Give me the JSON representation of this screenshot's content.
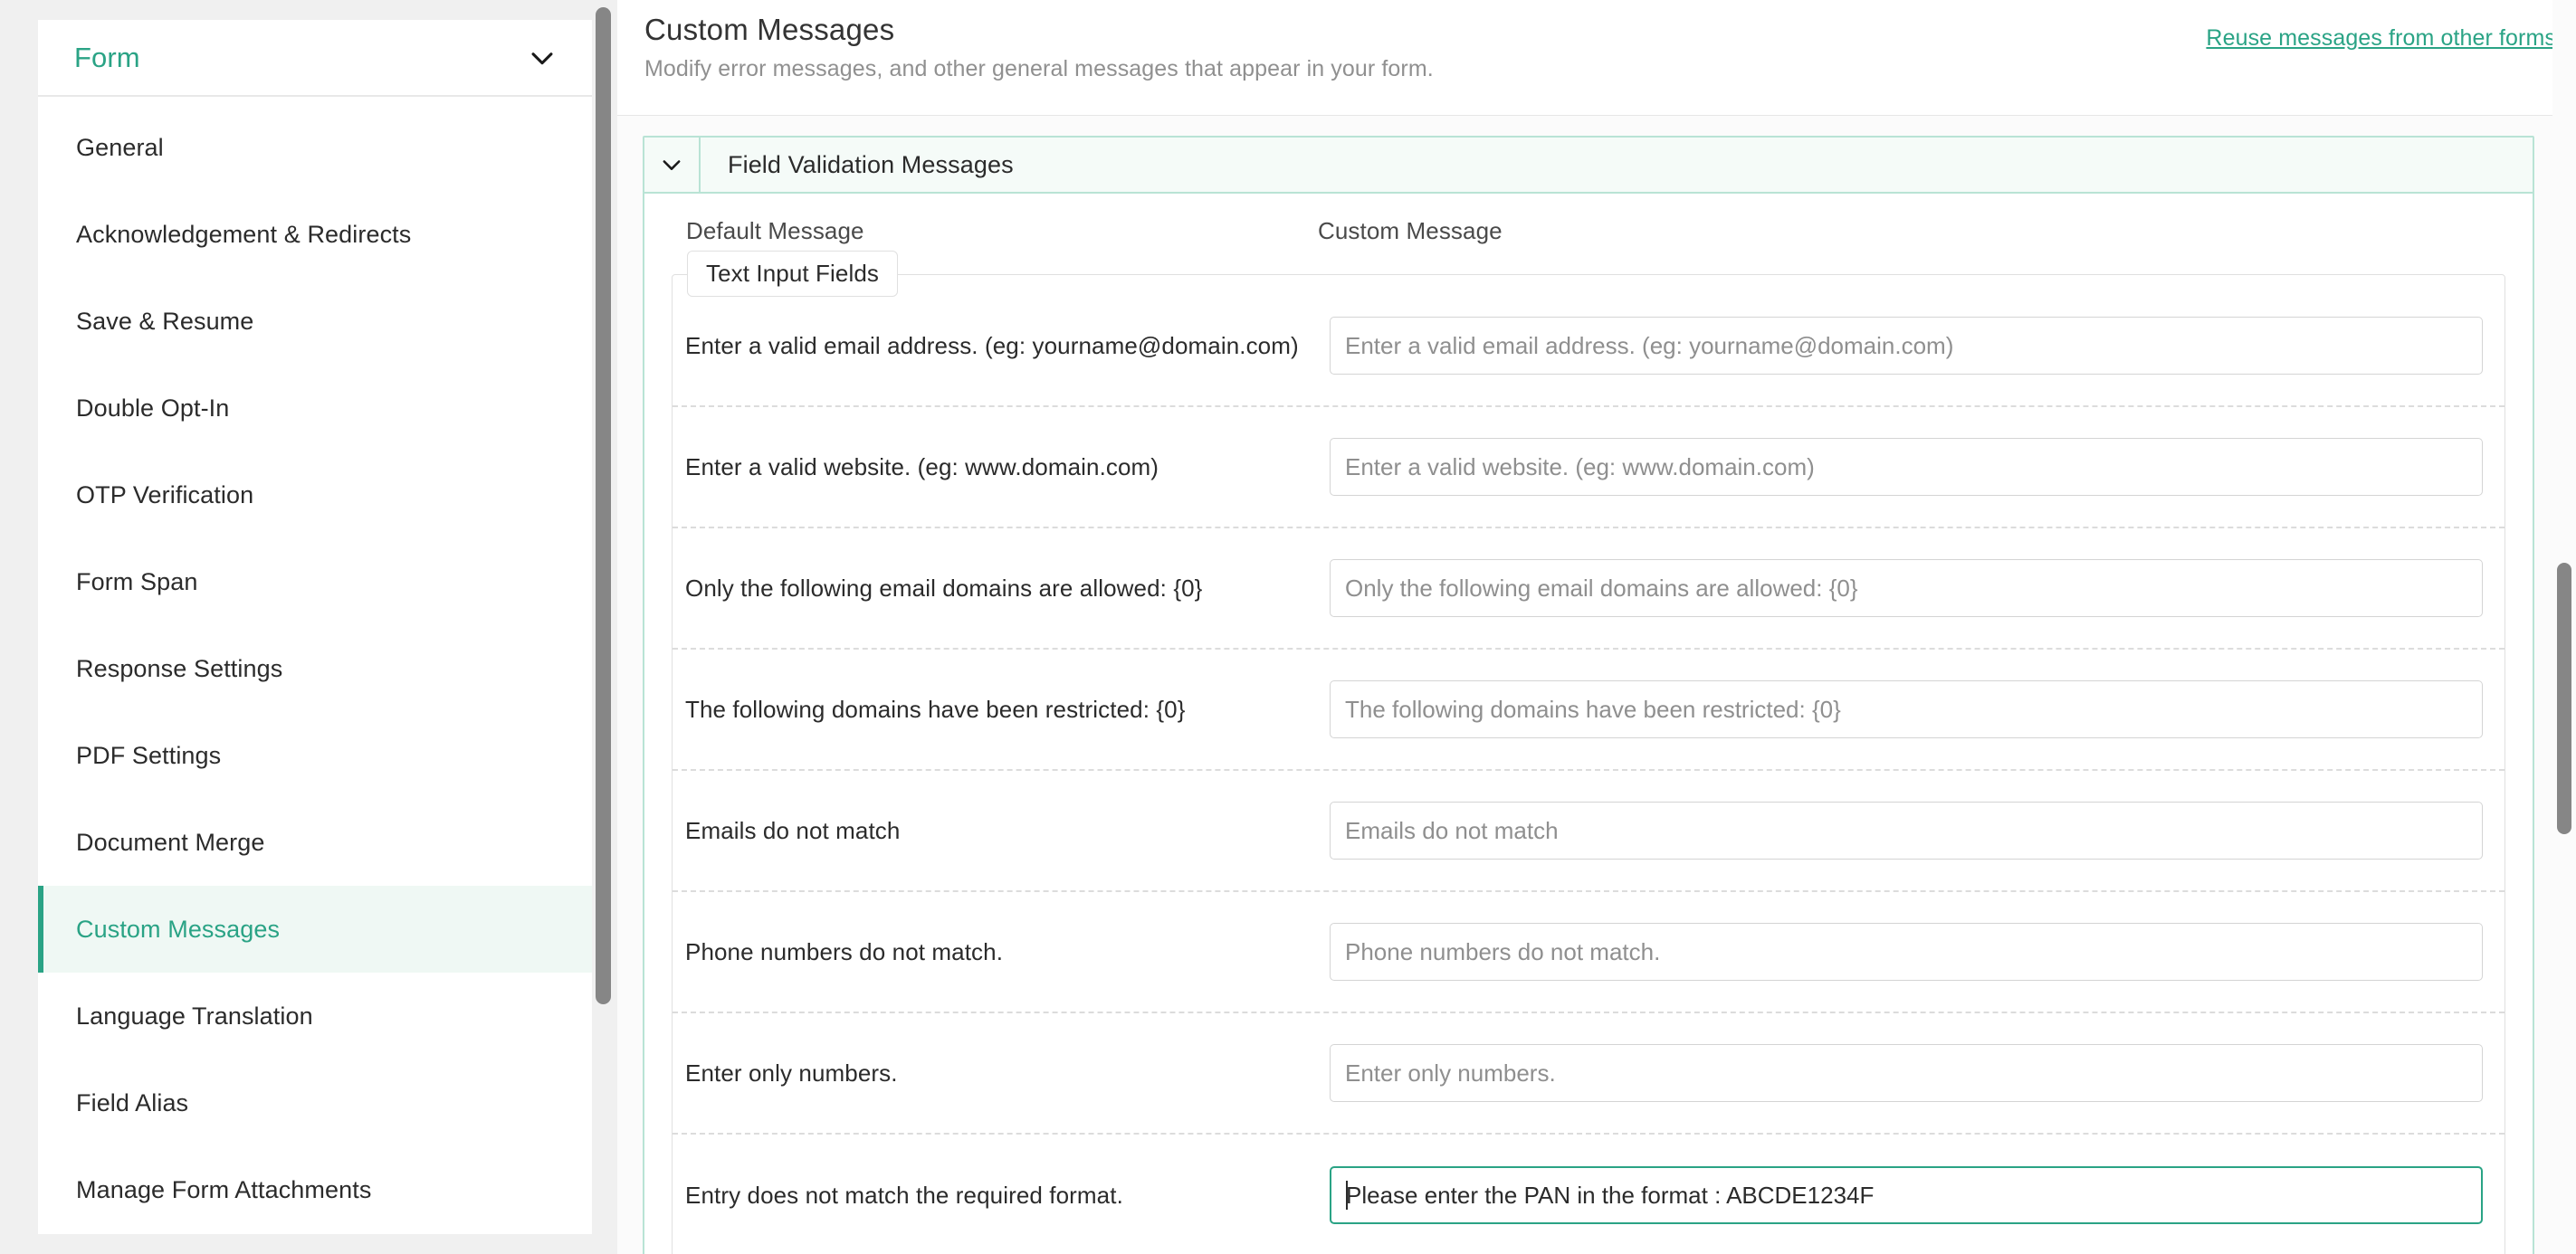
{
  "accent_color": "#2aa385",
  "sidebar": {
    "title": "Form",
    "toggle_icon": "chevron-down-icon",
    "items": [
      {
        "label": "General",
        "active": false
      },
      {
        "label": "Acknowledgement & Redirects",
        "active": false
      },
      {
        "label": "Save & Resume",
        "active": false
      },
      {
        "label": "Double Opt-In",
        "active": false
      },
      {
        "label": "OTP Verification",
        "active": false
      },
      {
        "label": "Form Span",
        "active": false
      },
      {
        "label": "Response Settings",
        "active": false
      },
      {
        "label": "PDF Settings",
        "active": false
      },
      {
        "label": "Document Merge",
        "active": false
      },
      {
        "label": "Custom Messages",
        "active": true
      },
      {
        "label": "Language Translation",
        "active": false
      },
      {
        "label": "Field Alias",
        "active": false
      },
      {
        "label": "Manage Form Attachments",
        "active": false
      }
    ]
  },
  "header": {
    "title": "Custom Messages",
    "subtitle": "Modify error messages, and other general messages that appear in your form.",
    "reuse_link": "Reuse messages from other forms"
  },
  "section": {
    "toggle_icon": "chevron-down-icon",
    "title": "Field Validation Messages",
    "columns": {
      "default": "Default Message",
      "custom": "Custom Message"
    },
    "fieldset_legend": "Text Input Fields",
    "rows": [
      {
        "default": "Enter a valid email address. (eg: yourname@domain.com)",
        "placeholder": "Enter a valid email address. (eg: yourname@domain.com)",
        "value": "",
        "focused": false
      },
      {
        "default": "Enter a valid website. (eg: www.domain.com)",
        "placeholder": "Enter a valid website. (eg: www.domain.com)",
        "value": "",
        "focused": false
      },
      {
        "default": "Only the following email domains are allowed: {0}",
        "placeholder": "Only the following email domains are allowed: {0}",
        "value": "",
        "focused": false
      },
      {
        "default": "The following domains have been restricted: {0}",
        "placeholder": "The following domains have been restricted: {0}",
        "value": "",
        "focused": false
      },
      {
        "default": "Emails do not match",
        "placeholder": "Emails do not match",
        "value": "",
        "focused": false
      },
      {
        "default": "Phone numbers do not match.",
        "placeholder": "Phone numbers do not match.",
        "value": "",
        "focused": false
      },
      {
        "default": "Enter only numbers.",
        "placeholder": "Enter only numbers.",
        "value": "",
        "focused": false
      },
      {
        "default": "Entry does not match the required format.",
        "placeholder": "Entry does not match the required format.",
        "value": "Please enter the PAN in the format : ABCDE1234F",
        "focused": true
      }
    ]
  }
}
